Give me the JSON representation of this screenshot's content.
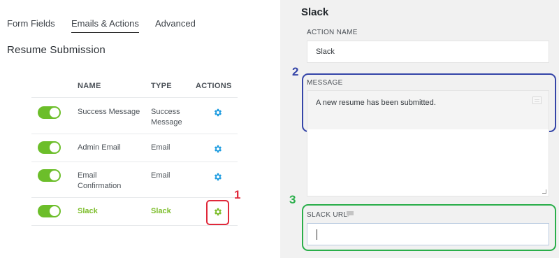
{
  "tabs": [
    {
      "label": "Form Fields"
    },
    {
      "label": "Emails & Actions",
      "active": true
    },
    {
      "label": "Advanced"
    }
  ],
  "form_title": "Resume Submission",
  "table": {
    "headers": {
      "name": "NAME",
      "type": "TYPE",
      "actions": "ACTIONS"
    },
    "rows": [
      {
        "name": "Success Message",
        "type": "Success Message",
        "enabled": true,
        "action_icon": "gear-icon"
      },
      {
        "name": "Admin Email",
        "type": "Email",
        "enabled": true,
        "action_icon": "gear-icon"
      },
      {
        "name": "Email Confirmation",
        "type": "Email",
        "enabled": true,
        "action_icon": "gear-icon"
      },
      {
        "name": "Slack",
        "type": "Slack",
        "enabled": true,
        "action_icon": "gear-icon",
        "highlighted": true
      }
    ]
  },
  "annotations": {
    "one": "1",
    "two": "2",
    "three": "3"
  },
  "panel": {
    "title": "Slack",
    "action_name_label": "ACTION NAME",
    "action_name_value": "Slack",
    "message_label": "MESSAGE",
    "message_value": "A new resume has been submitted.",
    "slack_url_label": "SLACK URL",
    "slack_url_value": ""
  },
  "colors": {
    "toggle_on": "#6cbe2a",
    "gear_default": "#1e9ce0",
    "gear_active": "#7cbd2a",
    "annotation_red": "#e0283a",
    "annotation_blue": "#3545a8",
    "annotation_green": "#2aae4a",
    "panel_bg": "#f1f1f1"
  }
}
